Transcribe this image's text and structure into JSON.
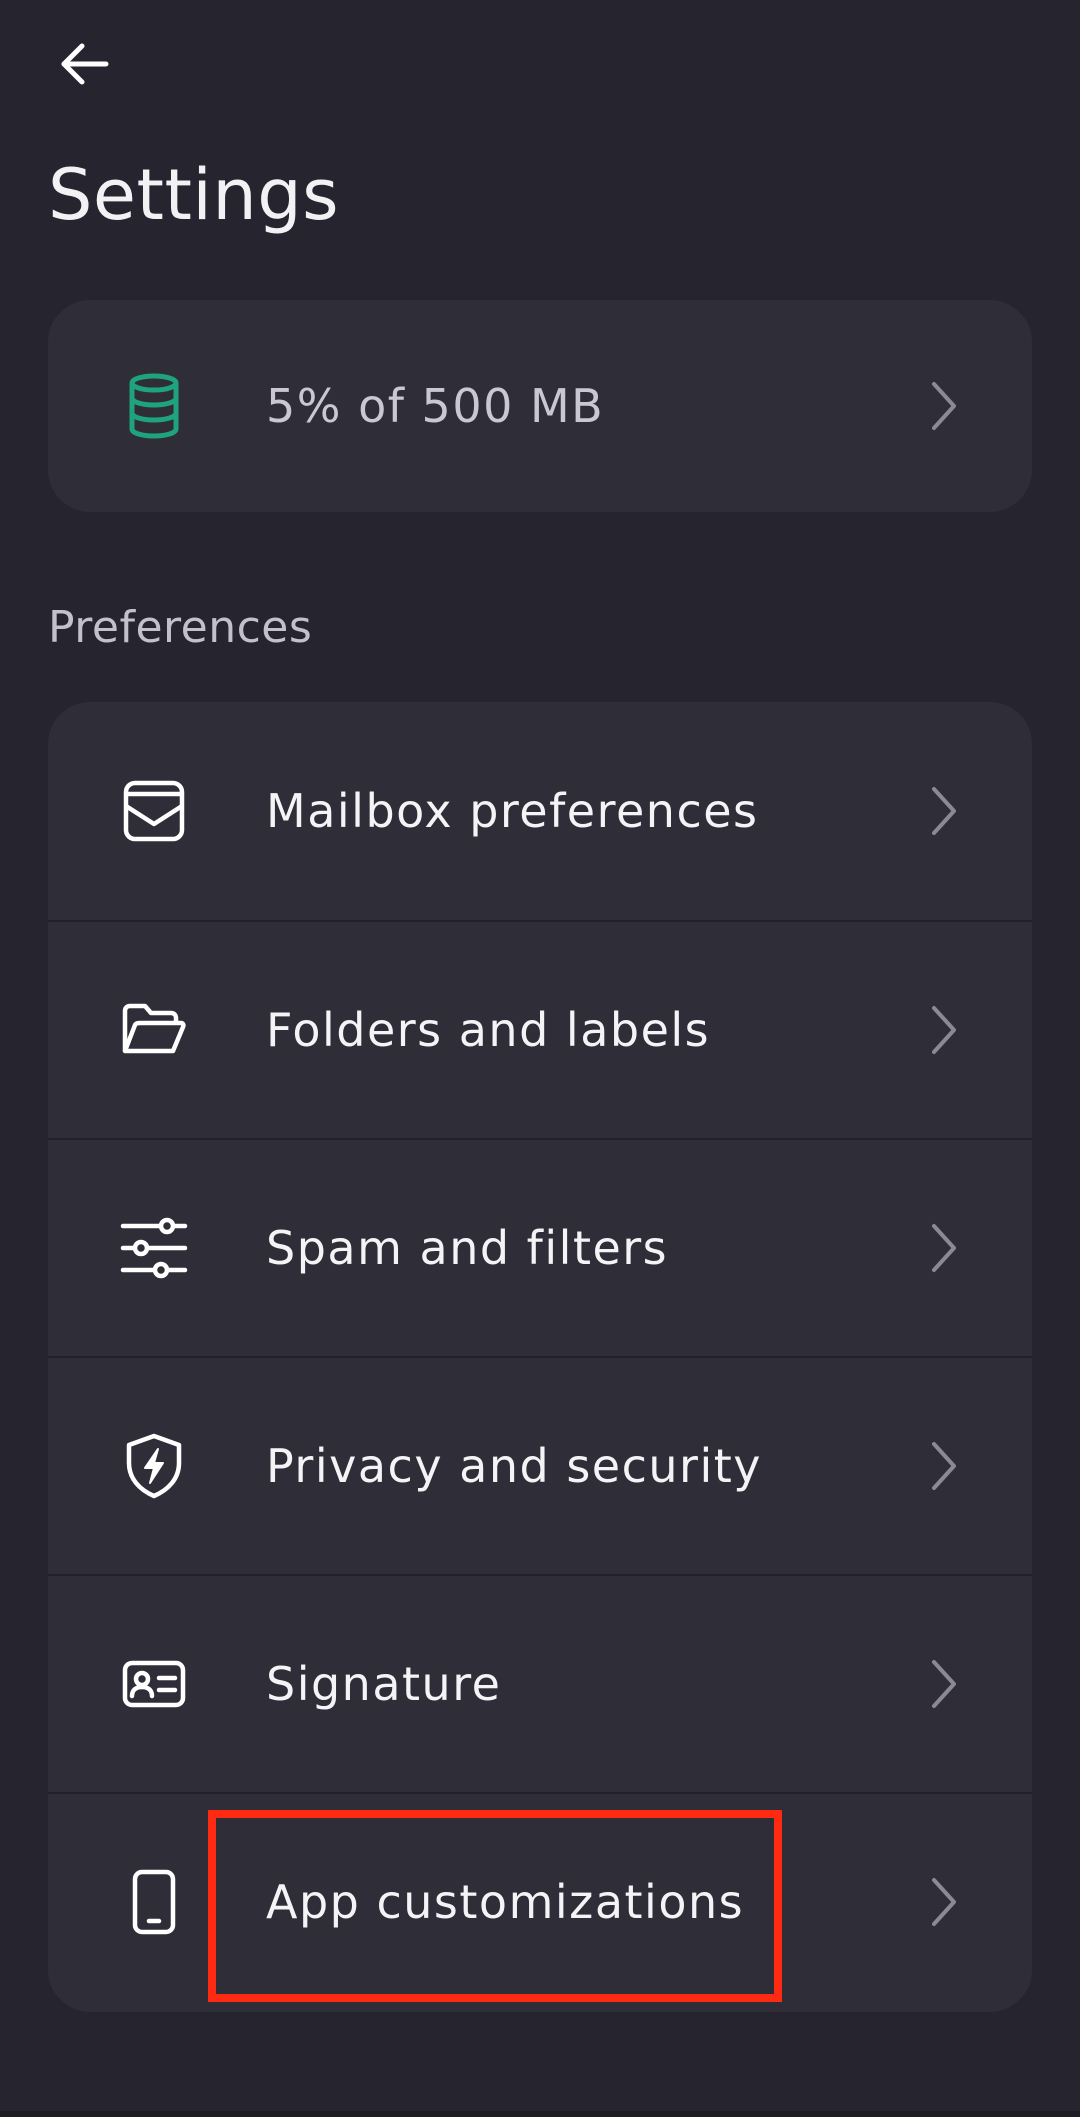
{
  "header": {
    "title": "Settings",
    "back_icon": "arrow-left-icon"
  },
  "storage": {
    "label": "5% of 500 MB",
    "icon": "database-icon",
    "icon_color": "#1fa37e",
    "usage_percent": 5
  },
  "preferences": {
    "section_title": "Preferences",
    "items": [
      {
        "label": "Mailbox preferences",
        "icon": "mailbox-icon"
      },
      {
        "label": "Folders and labels",
        "icon": "folder-open-icon"
      },
      {
        "label": "Spam and filters",
        "icon": "sliders-icon"
      },
      {
        "label": "Privacy and security",
        "icon": "shield-bolt-icon"
      },
      {
        "label": "Signature",
        "icon": "id-card-icon"
      },
      {
        "label": "App customizations",
        "icon": "phone-icon"
      }
    ]
  },
  "colors": {
    "background": "#25242f",
    "card": "#2e2d38",
    "highlight": "#ff2a12",
    "accent": "#1fa37e"
  }
}
